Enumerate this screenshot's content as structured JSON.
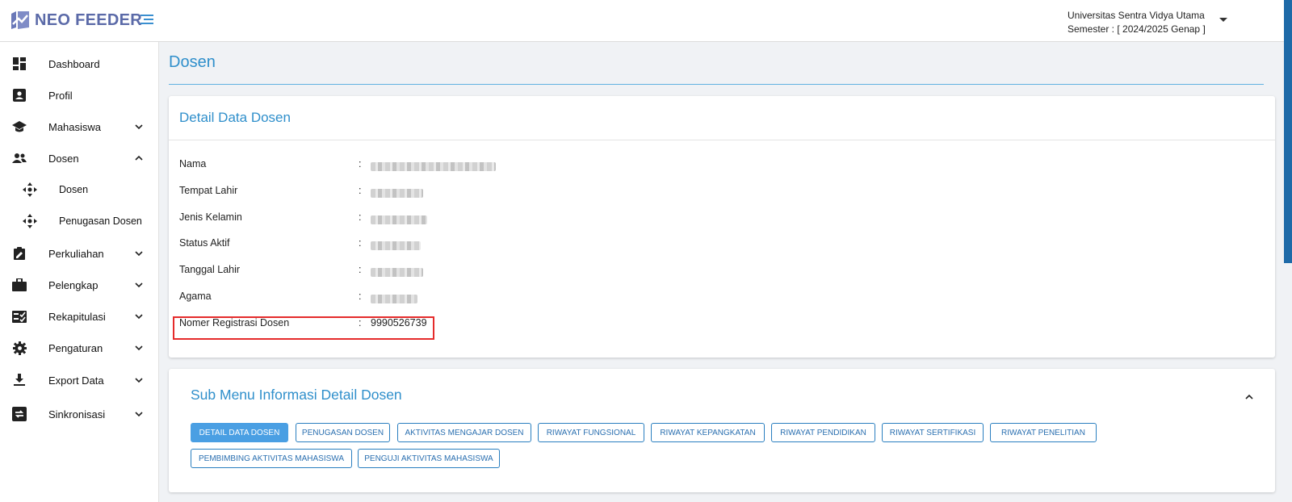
{
  "header": {
    "brand": "NEO FEEDER",
    "university": "Universitas Sentra Vidya Utama",
    "semester": "Semester : [ 2024/2025 Genap ]"
  },
  "sidebar": {
    "items": [
      {
        "label": "Dashboard",
        "icon": "dashboard-icon"
      },
      {
        "label": "Profil",
        "icon": "profile-card-icon"
      },
      {
        "label": "Mahasiswa",
        "icon": "graduation-cap-icon",
        "expanded": false
      },
      {
        "label": "Dosen",
        "icon": "people-icon",
        "expanded": true
      },
      {
        "label": "Dosen",
        "icon": "move-arrows-icon",
        "sub": true
      },
      {
        "label": "Penugasan Dosen",
        "icon": "move-arrows-icon",
        "sub": true
      },
      {
        "label": "Perkuliahan",
        "icon": "clipboard-edit-icon",
        "expanded": false
      },
      {
        "label": "Pelengkap",
        "icon": "briefcase-icon",
        "expanded": false
      },
      {
        "label": "Rekapitulasi",
        "icon": "checklist-icon",
        "expanded": false
      },
      {
        "label": "Pengaturan",
        "icon": "gear-icon",
        "expanded": false
      },
      {
        "label": "Export Data",
        "icon": "download-icon",
        "expanded": false
      },
      {
        "label": "Sinkronisasi",
        "icon": "sync-icon",
        "expanded": false
      }
    ]
  },
  "main": {
    "page_title": "Dosen",
    "detail_card": {
      "title": "Detail Data Dosen",
      "rows": [
        {
          "label": "Nama",
          "value": null,
          "redacted": true
        },
        {
          "label": "Tempat Lahir",
          "value": null,
          "redacted": true
        },
        {
          "label": "Jenis Kelamin",
          "value": null,
          "redacted": true
        },
        {
          "label": "Status Aktif",
          "value": null,
          "redacted": true
        },
        {
          "label": "Tanggal Lahir",
          "value": null,
          "redacted": true
        },
        {
          "label": "Agama",
          "value": null,
          "redacted": true
        },
        {
          "label": "Nomer Registrasi Dosen",
          "value": "9990526739",
          "redacted": false
        }
      ],
      "colon": ":"
    },
    "submenu_card": {
      "title": "Sub Menu Informasi Detail Dosen",
      "buttons": [
        {
          "label": "DETAIL DATA DOSEN",
          "active": true
        },
        {
          "label": "PENUGASAN DOSEN",
          "active": false
        },
        {
          "label": "AKTIVITAS MENGAJAR DOSEN",
          "active": false
        },
        {
          "label": "RIWAYAT FUNGSIONAL",
          "active": false
        },
        {
          "label": "RIWAYAT KEPANGKATAN",
          "active": false
        },
        {
          "label": "RIWAYAT PENDIDIKAN",
          "active": false
        },
        {
          "label": "RIWAYAT SERTIFIKASI",
          "active": false
        },
        {
          "label": "RIWAYAT PENELITIAN",
          "active": false
        },
        {
          "label": "PEMBIMBING AKTIVITAS MAHASISWA",
          "active": false
        },
        {
          "label": "PENGUJI AKTIVITAS MAHASISWA",
          "active": false
        }
      ]
    }
  },
  "colors": {
    "accent": "#2f8fcb",
    "button_active": "#4a9fe3",
    "highlight": "#e52b2b",
    "brand": "#5b6aa8"
  }
}
